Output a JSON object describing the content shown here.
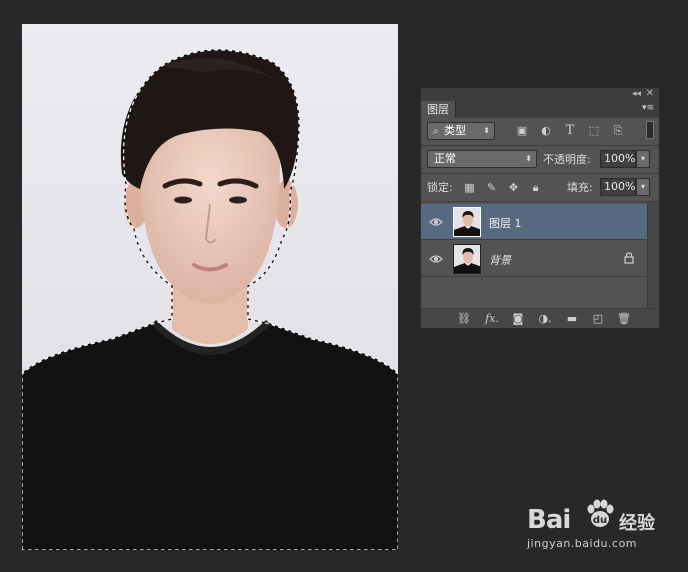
{
  "panel": {
    "tab_label": "图层",
    "filter_kind_label": "类型",
    "blend_mode": "正常",
    "opacity_label": "不透明度:",
    "opacity_value": "100%",
    "lock_label": "锁定:",
    "fill_label": "填充:",
    "fill_value": "100%"
  },
  "layers": [
    {
      "name": "图层 1",
      "selected": true,
      "locked": false
    },
    {
      "name": "背景",
      "selected": false,
      "locked": true
    }
  ],
  "icons": {
    "collapse": "double-chevron-icon",
    "close": "close-icon",
    "menu": "panel-menu-icon",
    "filter_types": [
      "pixel-filter-icon",
      "adjustment-filter-icon",
      "type-filter-icon",
      "shape-filter-icon",
      "smart-object-filter-icon"
    ],
    "lock_types": [
      "lock-transparent-icon",
      "lock-pixels-icon",
      "lock-position-icon",
      "lock-all-icon"
    ],
    "bottom": [
      "link-layers-icon",
      "fx-icon",
      "layer-mask-icon",
      "adjustment-layer-icon",
      "new-group-icon",
      "new-layer-icon",
      "delete-layer-icon"
    ]
  },
  "colors": {
    "app_bg": "#282828",
    "panel_bg": "#535353",
    "selected_layer": "#586a82"
  },
  "watermark": {
    "brand": "Bai",
    "brand_suffix": "经验",
    "url": "jingyan.baidu.com"
  }
}
